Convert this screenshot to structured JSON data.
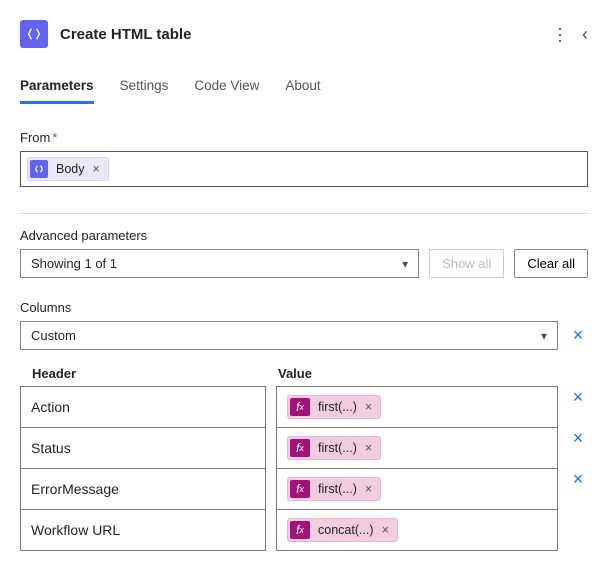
{
  "header": {
    "title": "Create HTML table"
  },
  "tabs": {
    "parameters": "Parameters",
    "settings": "Settings",
    "codeview": "Code View",
    "about": "About"
  },
  "from": {
    "label": "From",
    "token_label": "Body"
  },
  "advanced": {
    "label": "Advanced parameters",
    "showing": "Showing 1 of 1",
    "show_all": "Show all",
    "clear_all": "Clear all"
  },
  "columns": {
    "label": "Columns",
    "mode": "Custom",
    "header_col": "Header",
    "value_col": "Value",
    "rows": [
      {
        "header": "Action",
        "value_expr": "first(...)"
      },
      {
        "header": "Status",
        "value_expr": "first(...)"
      },
      {
        "header": "ErrorMessage",
        "value_expr": "first(...)"
      },
      {
        "header": "Workflow URL",
        "value_expr": "concat(...)"
      }
    ]
  }
}
